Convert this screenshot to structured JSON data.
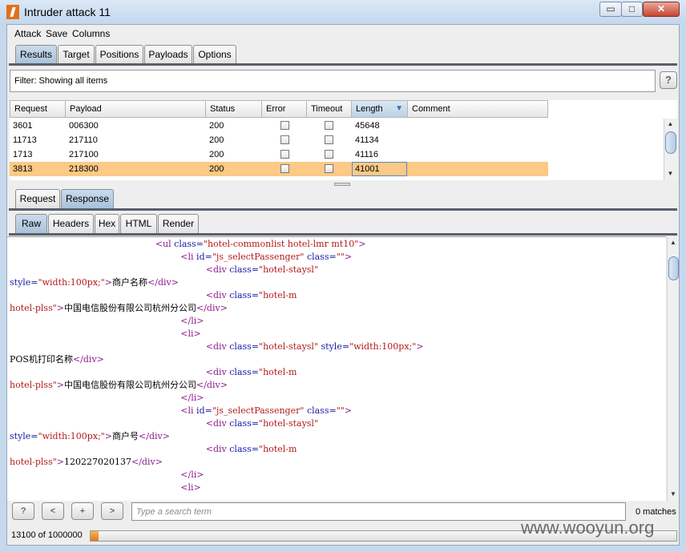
{
  "window": {
    "title": "Intruder attack 11",
    "controls": {
      "minimize": "▭",
      "maximize": "□",
      "close": "✕"
    }
  },
  "menu": [
    "Attack",
    "Save",
    "Columns"
  ],
  "main_tabs": [
    "Results",
    "Target",
    "Positions",
    "Payloads",
    "Options"
  ],
  "filter": {
    "text": "Filter:  Showing all items",
    "help": "?"
  },
  "table": {
    "columns": [
      "Request",
      "Payload",
      "Status",
      "Error",
      "Timeout",
      "Length",
      "Comment"
    ],
    "sort_indicator": "▼",
    "rows": [
      {
        "request": "3601",
        "payload": "006300",
        "status": "200",
        "length": "45648",
        "selected": false
      },
      {
        "request": "11713",
        "payload": "217110",
        "status": "200",
        "length": "41134",
        "selected": false
      },
      {
        "request": "1713",
        "payload": "217100",
        "status": "200",
        "length": "41116",
        "selected": false
      },
      {
        "request": "3813",
        "payload": "218300",
        "status": "200",
        "length": "41001",
        "selected": true
      }
    ]
  },
  "message_tabs": [
    "Request",
    "Response"
  ],
  "view_tabs": [
    "Raw",
    "Headers",
    "Hex",
    "HTML",
    "Render"
  ],
  "code_lines": [
    [
      {
        "t": "                                                    "
      },
      {
        "t": "<ul ",
        "c": "tag"
      },
      {
        "t": "class=",
        "c": "attr"
      },
      {
        "t": "\"hotel-commonlist hotel-lmr mt10\"",
        "c": "val"
      },
      {
        "t": ">",
        "c": "tag"
      }
    ],
    [
      {
        "t": "                                                             "
      },
      {
        "t": "<li ",
        "c": "tag"
      },
      {
        "t": "id=",
        "c": "attr"
      },
      {
        "t": "\"js_selectPassenger\" ",
        "c": "val"
      },
      {
        "t": "class=",
        "c": "attr"
      },
      {
        "t": "\"\"",
        "c": "val"
      },
      {
        "t": ">",
        "c": "tag"
      }
    ],
    [
      {
        "t": "                                                                      "
      },
      {
        "t": "<div ",
        "c": "tag"
      },
      {
        "t": "class=",
        "c": "attr"
      },
      {
        "t": "\"hotel-staysl\"",
        "c": "val"
      }
    ],
    [
      {
        "t": "style=",
        "c": "attr"
      },
      {
        "t": "\"width:100px;\"",
        "c": "val"
      },
      {
        "t": ">",
        "c": "tag"
      },
      {
        "t": "商户名称"
      },
      {
        "t": "</div>",
        "c": "tag"
      }
    ],
    [
      {
        "t": "                                                                      "
      },
      {
        "t": "<div ",
        "c": "tag"
      },
      {
        "t": "class=",
        "c": "attr"
      },
      {
        "t": "\"hotel-m",
        "c": "val"
      }
    ],
    [
      {
        "t": "hotel-plss\"",
        "c": "val"
      },
      {
        "t": ">",
        "c": "tag"
      },
      {
        "t": "中国电信股份有限公司杭州分公司"
      },
      {
        "t": "</div>",
        "c": "tag"
      }
    ],
    [
      {
        "t": "                                                             "
      },
      {
        "t": "</li>",
        "c": "tag"
      }
    ],
    [
      {
        "t": "                                                             "
      },
      {
        "t": "<li>",
        "c": "tag"
      }
    ],
    [
      {
        "t": "                                                                      "
      },
      {
        "t": "<div ",
        "c": "tag"
      },
      {
        "t": "class=",
        "c": "attr"
      },
      {
        "t": "\"hotel-staysl\" ",
        "c": "val"
      },
      {
        "t": "style=",
        "c": "attr"
      },
      {
        "t": "\"width:100px;\"",
        "c": "val"
      },
      {
        "t": ">",
        "c": "tag"
      }
    ],
    [
      {
        "t": "POS机打印名称"
      },
      {
        "t": "</div>",
        "c": "tag"
      }
    ],
    [
      {
        "t": "                                                                      "
      },
      {
        "t": "<div ",
        "c": "tag"
      },
      {
        "t": "class=",
        "c": "attr"
      },
      {
        "t": "\"hotel-m",
        "c": "val"
      }
    ],
    [
      {
        "t": "hotel-plss\"",
        "c": "val"
      },
      {
        "t": ">",
        "c": "tag"
      },
      {
        "t": "中国电信股份有限公司杭州分公司"
      },
      {
        "t": "</div>",
        "c": "tag"
      }
    ],
    [
      {
        "t": "                                                             "
      },
      {
        "t": "</li>",
        "c": "tag"
      }
    ],
    [
      {
        "t": "                                                             "
      },
      {
        "t": "<li ",
        "c": "tag"
      },
      {
        "t": "id=",
        "c": "attr"
      },
      {
        "t": "\"js_selectPassenger\" ",
        "c": "val"
      },
      {
        "t": "class=",
        "c": "attr"
      },
      {
        "t": "\"\"",
        "c": "val"
      },
      {
        "t": ">",
        "c": "tag"
      }
    ],
    [
      {
        "t": "                                                                      "
      },
      {
        "t": "<div ",
        "c": "tag"
      },
      {
        "t": "class=",
        "c": "attr"
      },
      {
        "t": "\"hotel-staysl\"",
        "c": "val"
      }
    ],
    [
      {
        "t": "style=",
        "c": "attr"
      },
      {
        "t": "\"width:100px;\"",
        "c": "val"
      },
      {
        "t": ">",
        "c": "tag"
      },
      {
        "t": "商户号"
      },
      {
        "t": "</div>",
        "c": "tag"
      }
    ],
    [
      {
        "t": "                                                                      "
      },
      {
        "t": "<div ",
        "c": "tag"
      },
      {
        "t": "class=",
        "c": "attr"
      },
      {
        "t": "\"hotel-m",
        "c": "val"
      }
    ],
    [
      {
        "t": "hotel-plss\"",
        "c": "val"
      },
      {
        "t": ">",
        "c": "tag"
      },
      {
        "t": "120227020137"
      },
      {
        "t": "</div>",
        "c": "tag"
      }
    ],
    [
      {
        "t": "                                                             "
      },
      {
        "t": "</li>",
        "c": "tag"
      }
    ],
    [
      {
        "t": "                                                             "
      },
      {
        "t": "<li>",
        "c": "tag"
      }
    ]
  ],
  "nav_buttons": [
    "?",
    "<",
    "+",
    ">"
  ],
  "search": {
    "placeholder": "Type a search term",
    "value": ""
  },
  "matches": "0 matches",
  "progress": {
    "label": "13100 of 1000000",
    "fraction": 0.0131
  },
  "watermark": "www.wooyun.org",
  "colors": {
    "selected_row": "#fcc986",
    "active_tab": "#b7cde3",
    "progress": "#f0952a"
  }
}
